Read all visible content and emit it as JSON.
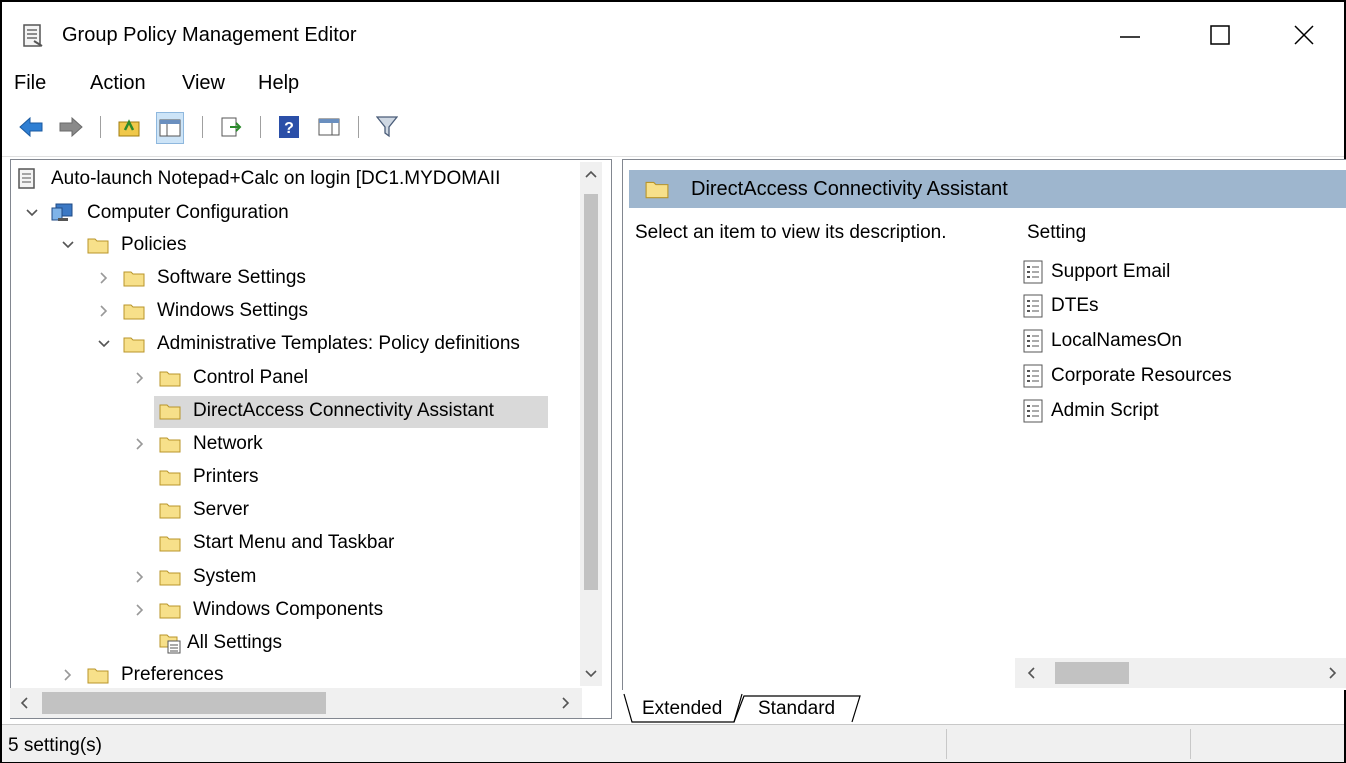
{
  "window": {
    "title": "Group Policy Management Editor",
    "controls": [
      "—",
      "☐",
      "✕"
    ]
  },
  "menu": [
    "File",
    "Action",
    "View",
    "Help"
  ],
  "toolbar": {
    "buttons": [
      "back-icon",
      "forward-icon",
      "up-folder-icon",
      "show-hide-tree-icon",
      "export-list-icon",
      "help-icon",
      "show-action-pane-icon",
      "filter-icon"
    ]
  },
  "tree": {
    "root": "Auto-launch Notepad+Calc on login [DC1.MYDOMAII",
    "computer_configuration": "Computer Configuration",
    "policies": "Policies",
    "software_settings": "Software Settings",
    "windows_settings": "Windows Settings",
    "admin_templates": "Administrative Templates: Policy definitions",
    "control_panel": "Control Panel",
    "directaccess": "DirectAccess Connectivity Assistant",
    "network": "Network",
    "printers": "Printers",
    "server": "Server",
    "start_menu": "Start Menu and Taskbar",
    "system": "System",
    "windows_components": "Windows Components",
    "all_settings": "All Settings",
    "preferences": "Preferences"
  },
  "right_pane": {
    "header": "DirectAccess Connectivity Assistant",
    "description": "Select an item to view its description.",
    "column_header": "Setting",
    "settings": [
      "Support Email",
      "DTEs",
      "LocalNamesOn",
      "Corporate Resources",
      "Admin Script"
    ]
  },
  "tabs": {
    "extended": "Extended",
    "standard": "Standard"
  },
  "status": {
    "text": "5 setting(s)"
  },
  "colors": {
    "selected_row": "#d9d9d9",
    "header_band": "#9eb6ce",
    "folder_fill": "#f7e08a"
  }
}
